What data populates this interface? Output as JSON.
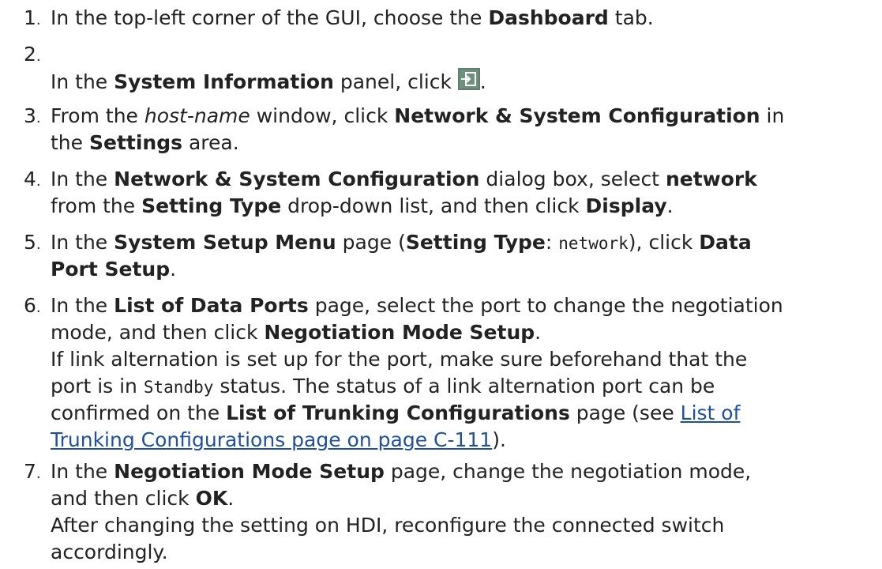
{
  "steps": [
    {
      "num": "1",
      "lines": [
        [
          "In the top-left corner of the GUI, choose the ",
          "Dashboard",
          " tab."
        ]
      ]
    },
    {
      "num": "2",
      "pre": "In the ",
      "bold": "System Information",
      "post": " panel, click ",
      "icon": "panel-launch-icon",
      "end": "."
    },
    {
      "num": "3",
      "l1_a": "From the ",
      "l1_i": "host-name",
      "l1_b": " window, click ",
      "l1_bold": "Network & System Configuration",
      "l1_c": " in",
      "l2_a": "the ",
      "l2_bold": "Settings",
      "l2_b": " area."
    },
    {
      "num": "4",
      "l1_a": "In the ",
      "l1_bold1": "Network & System Configuration",
      "l1_b": " dialog box, select ",
      "l1_bold2": "network",
      "l2_a": "from the ",
      "l2_bold1": "Setting Type",
      "l2_b": " drop-down list, and then click ",
      "l2_bold2": "Display",
      "l2_c": "."
    },
    {
      "num": "5",
      "l1_a": "In the ",
      "l1_bold1": "System Setup Menu",
      "l1_b": " page (",
      "l1_bold2": "Setting Type",
      "l1_c": ": ",
      "l1_mono": "network",
      "l1_d": "), click ",
      "l1_bold3": "Data",
      "l2_bold": "Port Setup",
      "l2_a": "."
    },
    {
      "num": "6",
      "l1_a": "In the ",
      "l1_bold": "List of Data Ports",
      "l1_b": " page, select the port to change the negotiation",
      "l2_a": "mode, and then click ",
      "l2_bold": "Negotiation Mode Setup",
      "l2_b": ".",
      "note_l1": "If link alternation is set up for the port, make sure beforehand that the",
      "note_l2_a": "port is in ",
      "note_l2_mono": "Standby",
      "note_l2_b": " status. The status of a link alternation port can be",
      "note_l3_a": "confirmed on the ",
      "note_l3_bold": "List of Trunking Configurations",
      "note_l3_b": " page (see ",
      "note_l3_link": "List of",
      "note_l4_link": "Trunking Configurations page on page C-111",
      "note_l4_a": ")."
    },
    {
      "num": "7",
      "l1_a": "In the ",
      "l1_bold": "Negotiation Mode Setup",
      "l1_b": " page, change the negotiation mode,",
      "l2_a": "and then click ",
      "l2_bold": "OK",
      "l2_b": ".",
      "note_l1": "After changing the setting on HDI, reconfigure the connected switch",
      "note_l2": "accordingly."
    }
  ],
  "colors": {
    "text": "#222222",
    "link": "#1f4fa0",
    "icon_bg": "#5e7f6e"
  }
}
